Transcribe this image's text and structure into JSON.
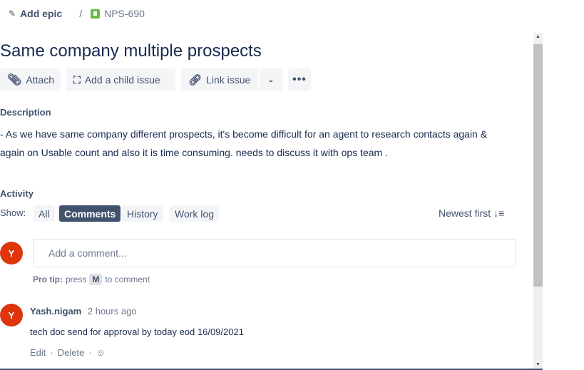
{
  "breadcrumb": {
    "epic": "Add epic",
    "separator": "/",
    "issue_key": "NPS-690"
  },
  "issue": {
    "title": "Same company multiple prospects"
  },
  "toolbar": {
    "attach": "Attach",
    "add_child": "Add a child issue",
    "link_issue": "Link issue"
  },
  "description": {
    "label": "Description",
    "text": "- As we have same company different prospects, it's become difficult for an agent to research contacts again & again on Usable count and also it is time consuming. needs to discuss it with ops team ."
  },
  "activity": {
    "label": "Activity",
    "show_label": "Show:",
    "filters": [
      "All",
      "Comments",
      "History",
      "Work log"
    ],
    "selected": "Comments",
    "sort": "Newest first"
  },
  "comment_box": {
    "avatar": "Y",
    "placeholder": "Add a comment...",
    "tip_bold": "Pro tip:",
    "tip_press": "press",
    "tip_key": "M",
    "tip_rest": "to comment"
  },
  "comments": [
    {
      "avatar": "Y",
      "author": "Yash.nigam",
      "time": "2 hours ago",
      "body": "tech doc send for approval by today eod 16/09/2021",
      "edit": "Edit",
      "delete": "Delete"
    }
  ],
  "colors": {
    "accent": "#42526e",
    "avatar": "#de350b",
    "story_icon": "#65ba43"
  }
}
